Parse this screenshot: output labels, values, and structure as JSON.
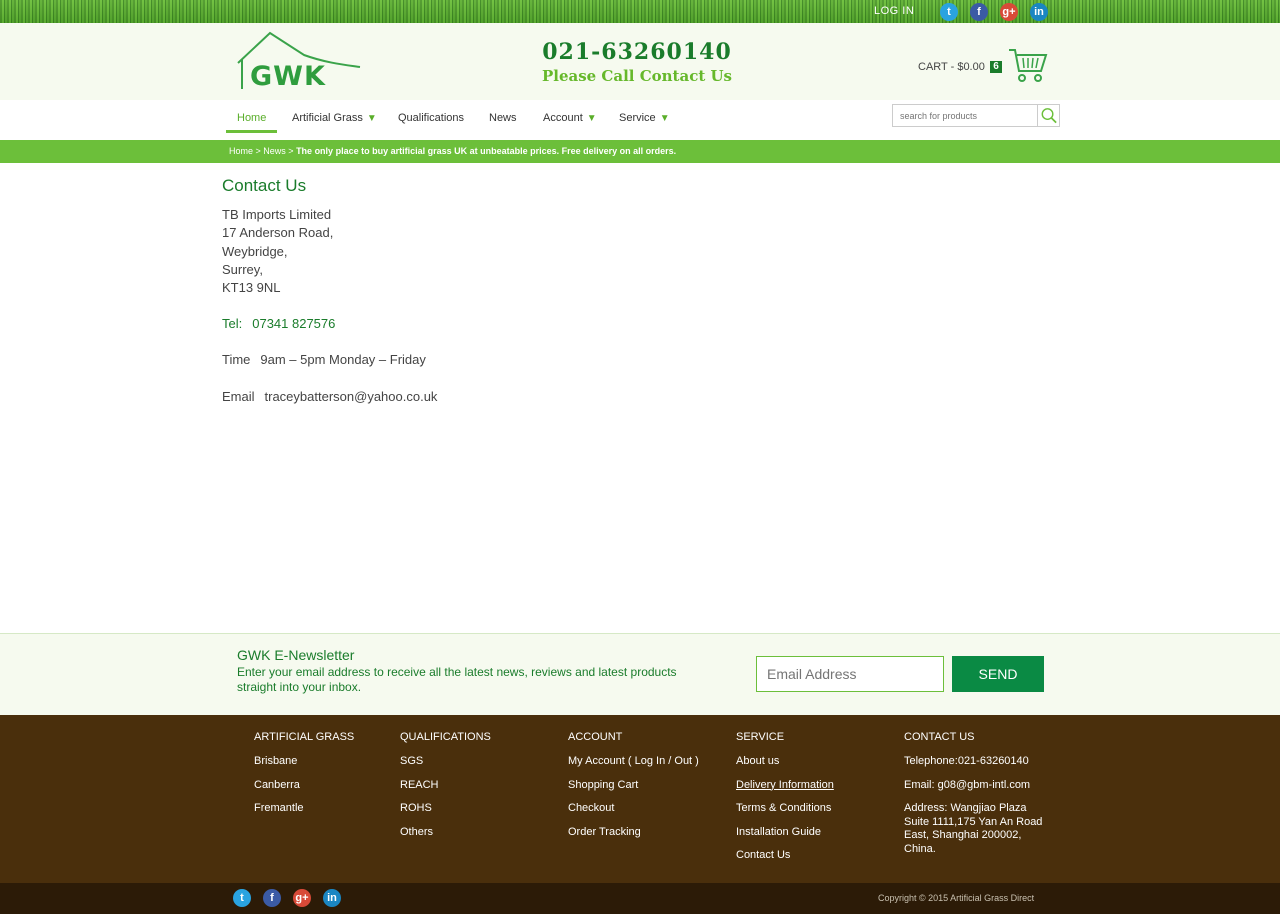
{
  "topbar": {
    "login": "LOG IN",
    "social": [
      {
        "icon": "twitter-icon",
        "glyph": "t"
      },
      {
        "icon": "facebook-icon",
        "glyph": "f"
      },
      {
        "icon": "google-plus-icon",
        "glyph": "g+"
      },
      {
        "icon": "linkedin-icon",
        "glyph": "in"
      }
    ]
  },
  "header": {
    "logo_text": "GWK",
    "phone": "021-63260140",
    "call_text": "Please Call Contact Us",
    "cart_label": "CART - $0.00",
    "cart_count": "6"
  },
  "nav": {
    "items": [
      {
        "label": "Home",
        "dropdown": false
      },
      {
        "label": "Artificial Grass",
        "dropdown": true
      },
      {
        "label": "Qualifications",
        "dropdown": false
      },
      {
        "label": "News",
        "dropdown": false
      },
      {
        "label": "Account",
        "dropdown": true
      },
      {
        "label": "Service",
        "dropdown": true
      }
    ],
    "dropdown_arrow": "▼",
    "search_placeholder": "search for products"
  },
  "breadcrumb": {
    "home": "Home",
    "sep": " > ",
    "news": "News",
    "message": "The only place to buy artificial grass UK at unbeatable prices. Free delivery on all orders."
  },
  "content": {
    "title": "Contact Us",
    "address": [
      "TB Imports Limited",
      "17 Anderson Road,",
      "Weybridge,",
      "Surrey,",
      "KT13 9NL"
    ],
    "tel_label": "Tel:",
    "tel_value": "07341 827576",
    "time_label": "Time",
    "time_value": "9am – 5pm Monday – Friday",
    "email_label": "Email",
    "email_value": "traceybatterson@yahoo.co.uk"
  },
  "newsletter": {
    "title": "GWK E-Newsletter",
    "description": "Enter your email address to receive all the latest news, reviews and latest products straight into your inbox.",
    "placeholder": "Email Address",
    "button": "SEND"
  },
  "footer": {
    "columns": [
      {
        "heading": "ARTIFICIAL GRASS",
        "links": [
          "Brisbane",
          "Canberra",
          "Fremantle"
        ]
      },
      {
        "heading": "QUALIFICATIONS",
        "links": [
          "SGS",
          "REACH",
          "ROHS",
          "Others"
        ]
      },
      {
        "heading": "ACCOUNT",
        "links": [
          "My Account ( Log In / Out )",
          "Shopping Cart",
          "Checkout",
          "Order Tracking"
        ]
      },
      {
        "heading": "SERVICE",
        "links": [
          "About us",
          "Delivery Information",
          "Terms & Conditions",
          "Installation Guide",
          "Contact Us"
        ]
      }
    ],
    "contact": {
      "heading": "CONTACT US",
      "telephone": "Telephone:021-63260140",
      "email": "Email: g08@gbm-intl.com",
      "address": "Address: Wangjiao Plaza Suite 1111,175 Yan An Road East, Shanghai 200002, China."
    },
    "copyright": "Copyright © 2015 Artificial Grass Direct"
  },
  "colors": {
    "brand_green": "#1a7c2b",
    "accent_green": "#6cbf3a",
    "footer_brown": "#4a2f0c"
  }
}
